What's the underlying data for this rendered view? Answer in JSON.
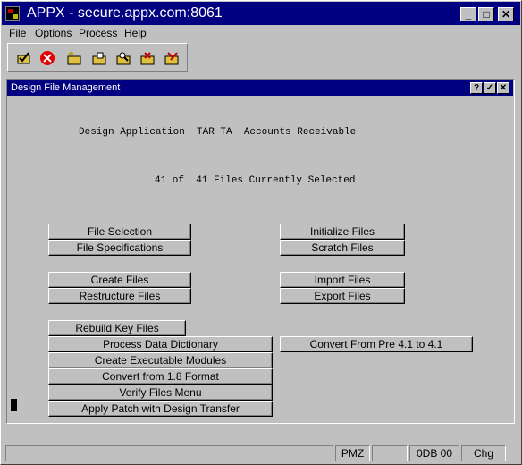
{
  "window": {
    "title": "APPX - secure.appx.com:8061",
    "minimize_label": "_",
    "maximize_label": "□",
    "close_label": "✕"
  },
  "menubar": {
    "items": [
      {
        "label": "File"
      },
      {
        "label": "Options"
      },
      {
        "label": "Process"
      },
      {
        "label": "Help"
      }
    ]
  },
  "toolbar": {
    "icons": [
      "check-folder-icon",
      "cancel-icon",
      "new-folder-icon",
      "open-folder-icon",
      "find-folder-icon",
      "delete-folder-icon",
      "edit-folder-icon"
    ]
  },
  "inner_window": {
    "title": "Design File Management",
    "help_label": "?",
    "check_label": "✓",
    "close_label": "✕"
  },
  "content": {
    "header_line": "Design Application  TAR TA  Accounts Receivable",
    "selection_line": "41 of  41 Files Currently Selected"
  },
  "buttons": {
    "file_selection": "File Selection",
    "file_specifications": "File Specifications",
    "initialize_files": "Initialize Files",
    "scratch_files": "Scratch Files",
    "create_files": "Create Files",
    "restructure_files": "Restructure Files",
    "import_files": "Import Files",
    "export_files": "Export Files",
    "rebuild_key_files": "Rebuild Key Files",
    "process_data_dictionary": "Process Data Dictionary",
    "convert_from_pre": "Convert From Pre 4.1 to 4.1",
    "create_executable_modules": "Create Executable Modules",
    "convert_from_18": "Convert from 1.8 Format",
    "verify_files_menu": "Verify Files Menu",
    "apply_patch": "Apply Patch with Design Transfer"
  },
  "statusbar": {
    "cells": [
      "",
      "PMZ",
      "",
      "0DB 00",
      "Chg"
    ]
  }
}
